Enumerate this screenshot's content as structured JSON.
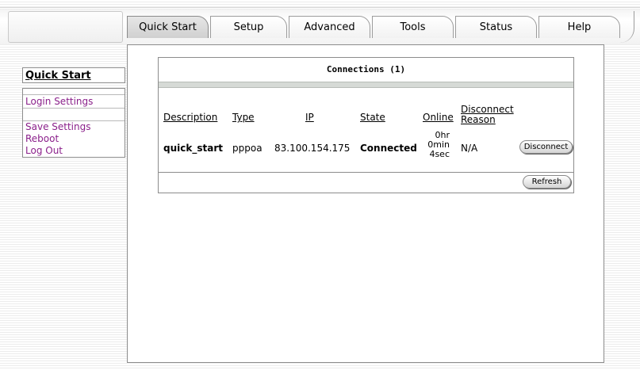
{
  "tabs": [
    {
      "label": "Quick Start",
      "active": true
    },
    {
      "label": "Setup",
      "active": false
    },
    {
      "label": "Advanced",
      "active": false
    },
    {
      "label": "Tools",
      "active": false
    },
    {
      "label": "Status",
      "active": false
    },
    {
      "label": "Help",
      "active": false
    }
  ],
  "sidebar": {
    "title": "Quick Start",
    "items": [
      {
        "label": "Login Settings"
      },
      {
        "label": "Save Settings"
      },
      {
        "label": "Reboot"
      },
      {
        "label": "Log Out"
      }
    ]
  },
  "connections": {
    "title": "Connections (1)",
    "headers": {
      "description": "Description",
      "type": "Type",
      "ip": "IP",
      "state": "State",
      "online": "Online",
      "disconnect_reason_line1": "Disconnect",
      "disconnect_reason_line2": "Reason"
    },
    "rows": [
      {
        "description": "quick_start",
        "type": "pppoa",
        "ip": "83.100.154.175",
        "state": "Connected",
        "online_line1": "0hr",
        "online_line2": "0min",
        "online_line3": "4sec",
        "reason": "N/A",
        "action_label": "Disconnect"
      }
    ],
    "refresh_label": "Refresh"
  },
  "colors": {
    "link": "#8a1f8a",
    "border": "#8c8c8c",
    "bar": "#d6dad6"
  }
}
